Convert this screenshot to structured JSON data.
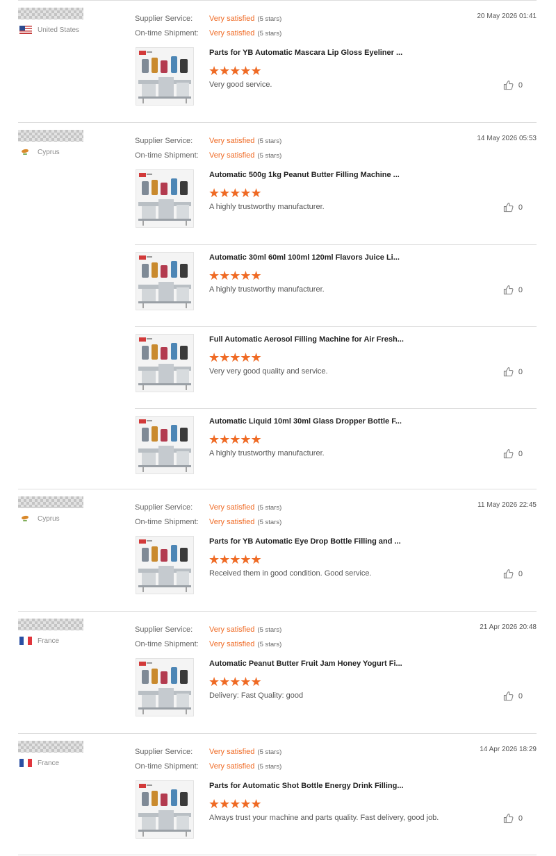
{
  "labels": {
    "supplier_service": "Supplier Service:",
    "ontime_shipment": "On-time Shipment:"
  },
  "icons": {
    "like": "thumbs-up-icon",
    "rating": "star-icon"
  },
  "colors": {
    "accent": "#ef6a24"
  },
  "reviews": [
    {
      "country": "United States",
      "flag": "us",
      "date": "20 May 2026 01:41",
      "supplier_rating": "Very satisfied",
      "supplier_count": "(5 stars)",
      "shipment_rating": "Very satisfied",
      "shipment_count": "(5 stars)",
      "products": [
        {
          "name": "Parts for YB Automatic Mascara Lip Gloss Eyeliner ...",
          "stars": "★★★★★",
          "comment": "Very good service.",
          "likes": "0"
        }
      ]
    },
    {
      "country": "Cyprus",
      "flag": "cy",
      "date": "14 May 2026 05:53",
      "supplier_rating": "Very satisfied",
      "supplier_count": "(5 stars)",
      "shipment_rating": "Very satisfied",
      "shipment_count": "(5 stars)",
      "products": [
        {
          "name": "Automatic 500g 1kg Peanut Butter Filling Machine ...",
          "stars": "★★★★★",
          "comment": "A highly trustworthy manufacturer.",
          "likes": "0"
        },
        {
          "name": "Automatic 30ml 60ml 100ml 120ml Flavors Juice Li...",
          "stars": "★★★★★",
          "comment": "A highly trustworthy manufacturer.",
          "likes": "0"
        },
        {
          "name": "Full Automatic Aerosol Filling Machine for Air Fresh...",
          "stars": "★★★★★",
          "comment": "Very very good quality and service.",
          "likes": "0"
        },
        {
          "name": "Automatic Liquid 10ml 30ml Glass Dropper Bottle F...",
          "stars": "★★★★★",
          "comment": "A highly trustworthy manufacturer.",
          "likes": "0"
        }
      ]
    },
    {
      "country": "Cyprus",
      "flag": "cy",
      "date": "11 May 2026 22:45",
      "supplier_rating": "Very satisfied",
      "supplier_count": "(5 stars)",
      "shipment_rating": "Very satisfied",
      "shipment_count": "(5 stars)",
      "products": [
        {
          "name": "Parts for YB Automatic Eye Drop Bottle Filling and ...",
          "stars": "★★★★★",
          "comment": "Received them in good condition.  Good service.",
          "likes": "0"
        }
      ]
    },
    {
      "country": "France",
      "flag": "fr",
      "date": "21 Apr 2026 20:48",
      "supplier_rating": "Very satisfied",
      "supplier_count": "(5 stars)",
      "shipment_rating": "Very satisfied",
      "shipment_count": "(5 stars)",
      "products": [
        {
          "name": "Automatic Peanut Butter Fruit Jam Honey Yogurt Fi...",
          "stars": "★★★★★",
          "comment": "Delivery:  Fast  Quality:  good",
          "likes": "0"
        }
      ]
    },
    {
      "country": "France",
      "flag": "fr",
      "date": "14 Apr 2026 18:29",
      "supplier_rating": "Very satisfied",
      "supplier_count": "(5 stars)",
      "shipment_rating": "Very satisfied",
      "shipment_count": "(5 stars)",
      "products": [
        {
          "name": "Parts for Automatic Shot Bottle Energy Drink Filling...",
          "stars": "★★★★★",
          "comment": "Always trust your machine and parts quality. Fast delivery, good job.",
          "likes": "0"
        }
      ]
    }
  ]
}
